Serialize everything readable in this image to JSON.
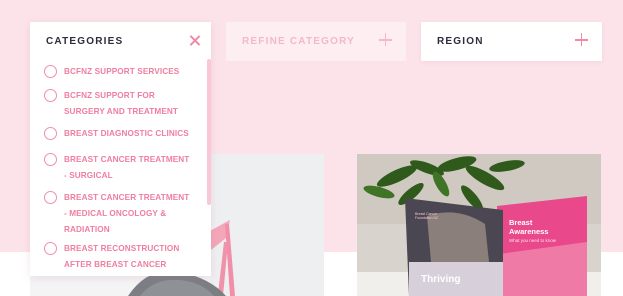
{
  "filters": {
    "categories": {
      "label": "CATEGORIES",
      "close_icon": "close-icon"
    },
    "refine": {
      "label": "REFINE CATEGORY",
      "icon": "plus-icon"
    },
    "region": {
      "label": "REGION",
      "icon": "plus-icon"
    }
  },
  "category_options": [
    "BCFNZ SUPPORT SERVICES",
    "BCFNZ SUPPORT FOR SURGERY AND TREATMENT",
    "BREAST DIAGNOSTIC CLINICS",
    "BREAST CANCER TREATMENT - SURGICAL",
    "BREAST CANCER TREATMENT - MEDICAL ONCOLOGY & RADIATION",
    "BREAST RECONSTRUCTION AFTER BREAST CANCER"
  ],
  "brochures": {
    "thriving_title": "Thriving",
    "awareness_title": "Breast Awareness",
    "awareness_subtitle": "What you need to know",
    "foundation_text": "Breast Cancer Foundation NZ"
  },
  "colors": {
    "background_band": "#fce3ea",
    "accent": "#f08aa6",
    "category_text": "#ef7ea0",
    "heading_text": "#2f2b3d",
    "disabled_text": "#f6b7c8"
  }
}
